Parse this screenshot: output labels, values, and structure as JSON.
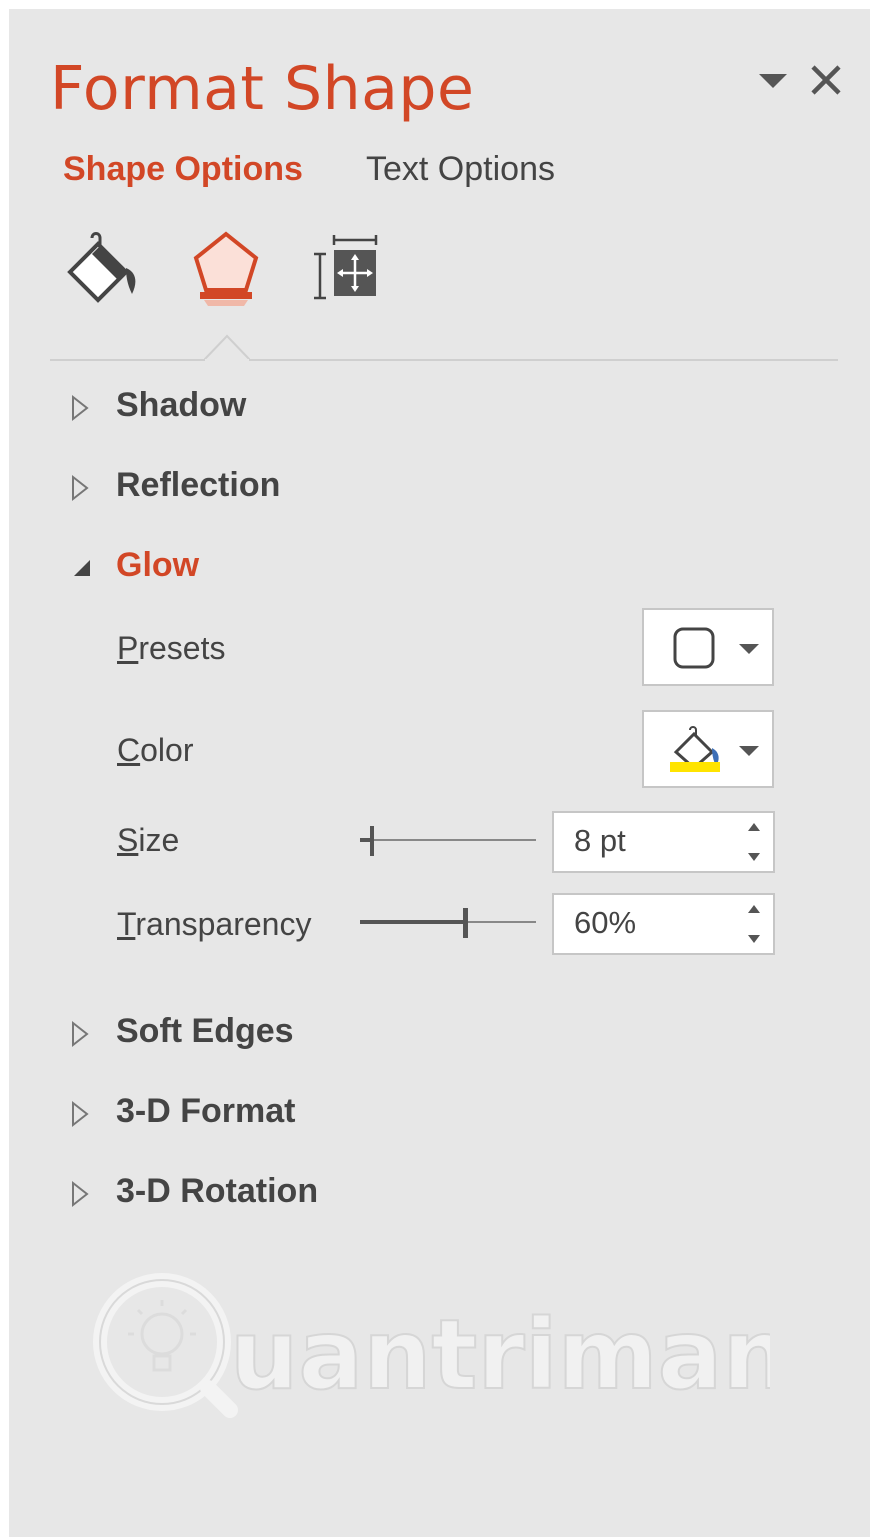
{
  "panel": {
    "title": "Format Shape",
    "tabs": [
      "Shape Options",
      "Text Options"
    ],
    "active_tab": "Shape Options",
    "icon_tabs": [
      "fill-line-icon",
      "effects-icon",
      "size-properties-icon"
    ],
    "active_icon_tab": "effects-icon"
  },
  "sections": {
    "shadow": "Shadow",
    "reflection": "Reflection",
    "glow": "Glow",
    "soft_edges": "Soft Edges",
    "format_3d": "3-D Format",
    "rotation_3d": "3-D Rotation"
  },
  "glow": {
    "presets_label_first": "P",
    "presets_label_rest": "resets",
    "color_label_first": "C",
    "color_label_rest": "olor",
    "size_label_first": "S",
    "size_label_rest": "ize",
    "transparency_label_first": "T",
    "transparency_label_rest": "ransparency",
    "size_value": "8 pt",
    "transparency_value": "60%",
    "size_slider_fraction": 0.05,
    "transparency_slider_fraction": 0.6,
    "color_swatch": "#ffe400"
  },
  "colors": {
    "accent": "#d24726",
    "text": "#444444",
    "background": "#e7e7e7"
  },
  "watermark": {
    "text": "uantrimang"
  }
}
